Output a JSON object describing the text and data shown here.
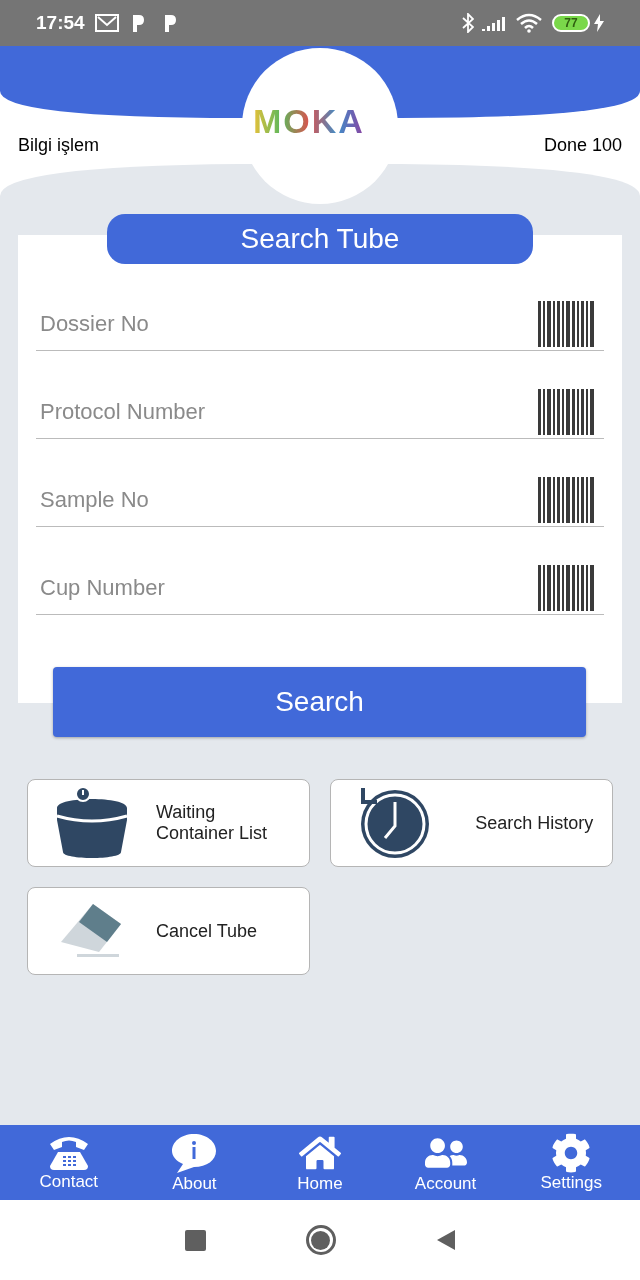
{
  "status_bar": {
    "time": "17:54",
    "battery": "77"
  },
  "header": {
    "user": "Bilgi işlem",
    "logo": "MOKA",
    "status": "Done 100"
  },
  "search_card": {
    "title": "Search Tube",
    "fields": [
      {
        "placeholder": "Dossier No"
      },
      {
        "placeholder": "Protocol Number"
      },
      {
        "placeholder": "Sample No"
      },
      {
        "placeholder": "Cup Number"
      }
    ],
    "button": "Search"
  },
  "tiles": [
    {
      "kind": "container",
      "label": "Waiting Container List"
    },
    {
      "kind": "history",
      "label": "Search History"
    },
    {
      "kind": "eraser",
      "label": "Cancel Tube"
    }
  ],
  "bottom_nav": [
    {
      "kind": "phone",
      "label": "Contact"
    },
    {
      "kind": "info",
      "label": "About"
    },
    {
      "kind": "home",
      "label": "Home"
    },
    {
      "kind": "users",
      "label": "Account"
    },
    {
      "kind": "gear",
      "label": "Settings"
    }
  ]
}
